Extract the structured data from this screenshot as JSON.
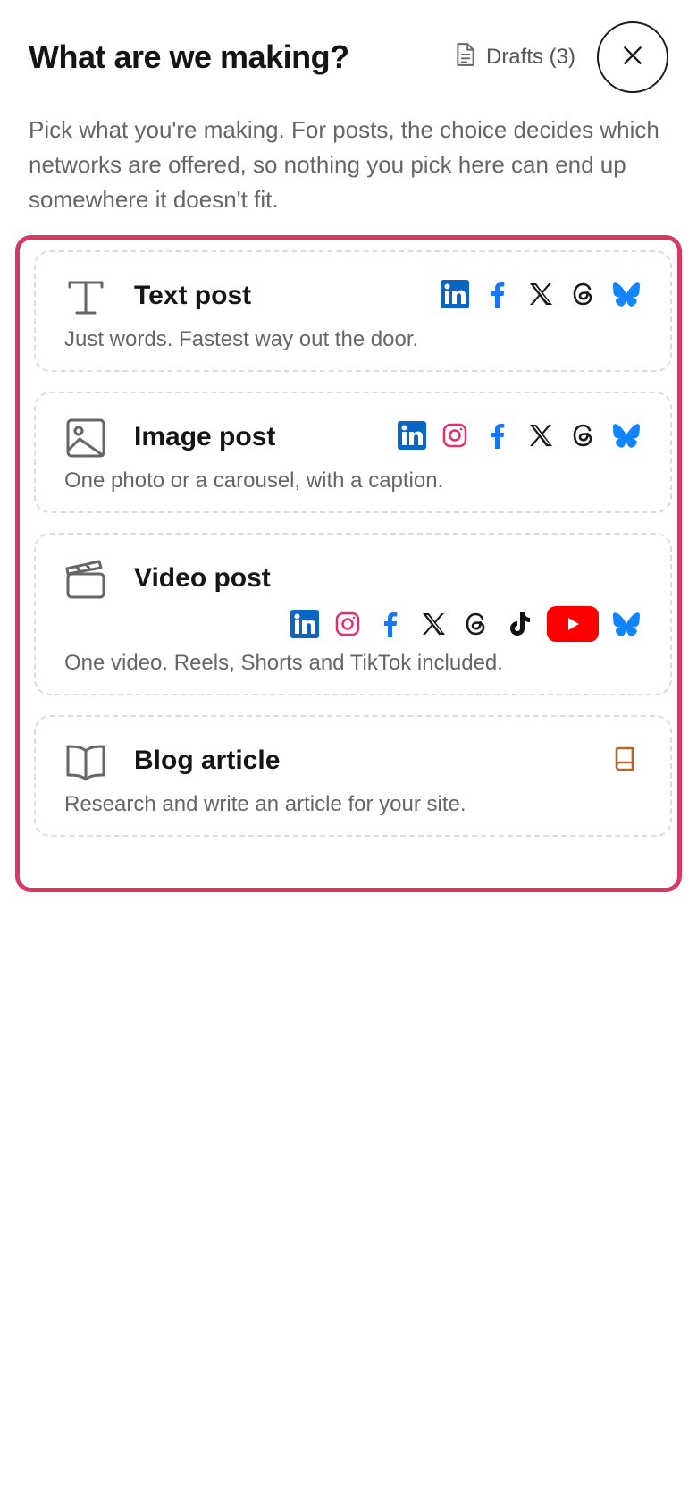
{
  "header": {
    "title": "What are we making?",
    "drafts_label": "Drafts (3)"
  },
  "intro": "Pick what you're making. For posts, the choice decides which networks are offered, so nothing you pick here can end up somewhere it doesn't fit.",
  "colors": {
    "accent_border": "#d63a63",
    "linkedin": "#0a66c2",
    "instagram": "#e1306c",
    "facebook": "#1877f2",
    "youtube": "#ff0000",
    "bluesky": "#1185fe",
    "blog": "#b5652a"
  },
  "options": [
    {
      "title": "Text post",
      "desc": "Just words. Fastest way out the door.",
      "icon": "text-icon",
      "networks": [
        "linkedin",
        "facebook",
        "x",
        "threads",
        "bluesky"
      ]
    },
    {
      "title": "Image post",
      "desc": "One photo or a carousel, with a caption.",
      "icon": "image-icon",
      "networks": [
        "linkedin",
        "instagram",
        "facebook",
        "x",
        "threads",
        "bluesky"
      ]
    },
    {
      "title": "Video post",
      "desc": "One video. Reels, Shorts and TikTok included.",
      "icon": "clapperboard-icon",
      "networks": [
        "linkedin",
        "instagram",
        "facebook",
        "x",
        "threads",
        "tiktok",
        "youtube",
        "bluesky"
      ]
    },
    {
      "title": "Blog article",
      "desc": "Research and write an article for your site.",
      "icon": "book-open-icon",
      "networks": [
        "blog"
      ]
    }
  ]
}
